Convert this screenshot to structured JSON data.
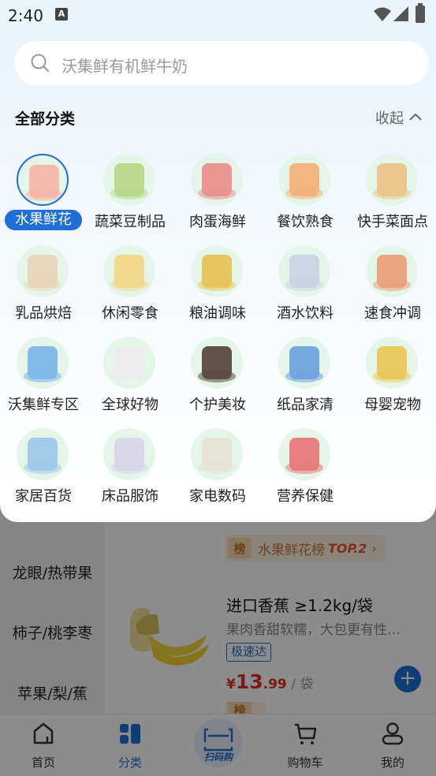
{
  "status_bar": {
    "time": "2:40",
    "notif_glyph": "A"
  },
  "search": {
    "placeholder": "沃集鲜有机鲜牛奶"
  },
  "section": {
    "title": "全部分类",
    "collapse_label": "收起"
  },
  "categories": [
    {
      "label": "水果鲜花",
      "active": true,
      "color": "#f3b7a8",
      "icon": "grapefruit-icon"
    },
    {
      "label": "蔬菜豆制品",
      "color": "#b5d98a",
      "icon": "lettuce-tofu-icon"
    },
    {
      "label": "肉蛋海鲜",
      "color": "#e99090",
      "icon": "meat-icon"
    },
    {
      "label": "餐饮熟食",
      "color": "#f2b27a",
      "icon": "sausage-icon"
    },
    {
      "label": "快手菜面点",
      "color": "#e9c48a",
      "icon": "noodle-pack-icon"
    },
    {
      "label": "乳品烘焙",
      "color": "#e7d6b8",
      "icon": "milk-bagel-icon"
    },
    {
      "label": "休闲零食",
      "color": "#f1d889",
      "icon": "snack-icon"
    },
    {
      "label": "粮油调味",
      "color": "#e8c25a",
      "icon": "oil-bottle-icon"
    },
    {
      "label": "酒水饮料",
      "color": "#c9d4e4",
      "icon": "drink-bottles-icon"
    },
    {
      "label": "速食冲调",
      "color": "#e9a07a",
      "icon": "instant-noodle-icon"
    },
    {
      "label": "沃集鲜专区",
      "color": "#7db6e8",
      "icon": "walmart-basket-icon"
    },
    {
      "label": "全球好物",
      "color": "#ececec",
      "icon": "cream-jar-icon"
    },
    {
      "label": "个护美妆",
      "color": "#5a4a42",
      "icon": "pump-bottle-icon"
    },
    {
      "label": "纸品家清",
      "color": "#6fa3dc",
      "icon": "tissue-pack-icon"
    },
    {
      "label": "母婴宠物",
      "color": "#e9c85a",
      "icon": "formula-can-icon"
    },
    {
      "label": "家居百货",
      "color": "#9fc9ea",
      "icon": "spray-bottle-icon"
    },
    {
      "label": "床品服饰",
      "color": "#d9d6e8",
      "icon": "bedding-icon"
    },
    {
      "label": "家电数码",
      "color": "#e6e1d8",
      "icon": "heater-icon"
    },
    {
      "label": "营养保健",
      "color": "#e57a7a",
      "icon": "gift-box-icon"
    }
  ],
  "background": {
    "side_categories": [
      "龙眼/热带果",
      "柿子/桃李枣",
      "苹果/梨/蕉"
    ],
    "rank_badge": "榜",
    "rank_text": "水果鲜花榜",
    "rank_top": "TOP.2",
    "product": {
      "title": "进口香蕉 ≥1.2kg/袋",
      "desc": "果肉香甜软糯，大包更有性…",
      "tag": "极速达",
      "currency": "¥",
      "price_int": "13",
      "price_dec": ".99",
      "unit": "/ 袋"
    }
  },
  "tabbar": [
    {
      "label": "首页",
      "icon": "home-icon"
    },
    {
      "label": "分类",
      "icon": "category-icon"
    },
    {
      "label": "扫码购",
      "icon": "scan-icon"
    },
    {
      "label": "购物车",
      "icon": "cart-icon"
    },
    {
      "label": "我的",
      "icon": "profile-icon"
    }
  ]
}
